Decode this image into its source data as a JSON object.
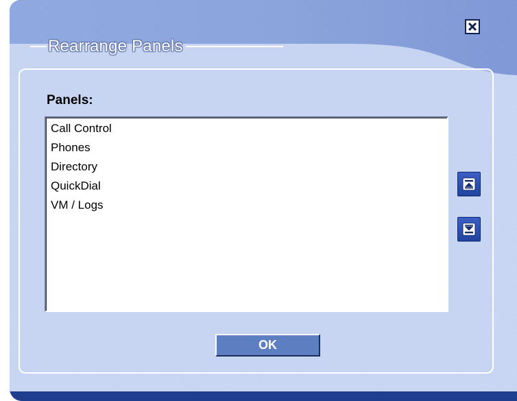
{
  "dialog": {
    "title": "Rearrange Panels",
    "close_icon": "close-x-icon"
  },
  "panels": {
    "label": "Panels:",
    "items": [
      "Call Control",
      "Phones",
      "Directory",
      "QuickDial",
      "VM / Logs"
    ]
  },
  "buttons": {
    "move_up_icon": "move-up-icon",
    "move_down_icon": "move-down-icon",
    "ok_label": "OK"
  },
  "colors": {
    "frame": "#1f3f8e",
    "header": "#8aa3dc",
    "body": "#c7d5f3",
    "button": "#5d7fc1"
  }
}
